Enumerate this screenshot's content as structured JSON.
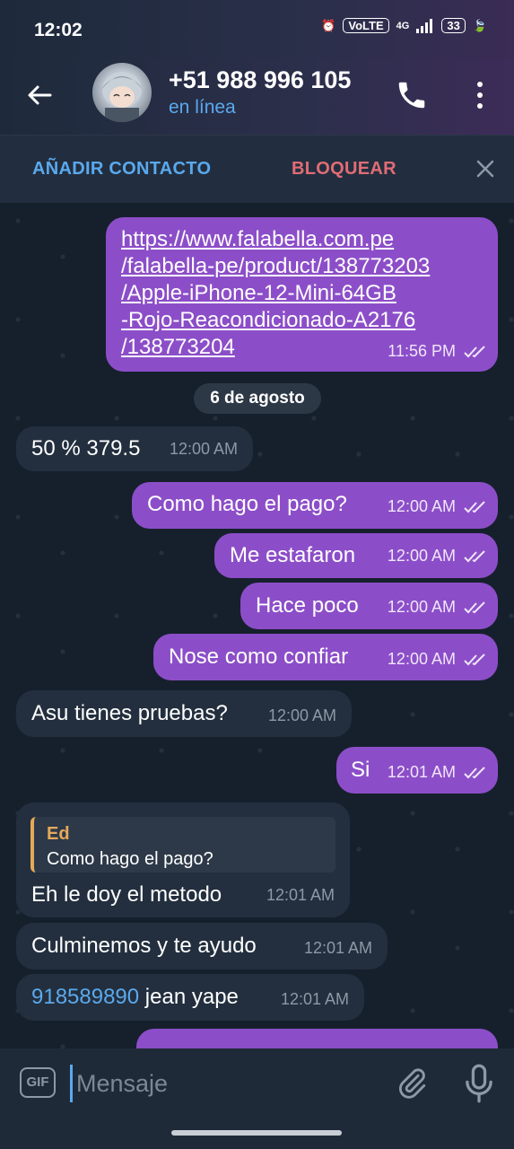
{
  "status": {
    "time": "12:02",
    "network": "4G",
    "volte": "VoLTE",
    "battery": "33"
  },
  "header": {
    "contact_name": "+51 988 996 105",
    "contact_status": "en línea"
  },
  "actions": {
    "add_contact": "AÑADIR CONTACTO",
    "block": "BLOQUEAR"
  },
  "chat": {
    "link_message": {
      "lines": [
        "https://www.falabella.com.pe",
        "/falabella-pe/product/138773203",
        "/Apple-iPhone-12-Mini-64GB",
        "-Rojo-Reacondicionado-A2176",
        "/138773204"
      ],
      "time": "11:56 PM"
    },
    "date_separator": "6 de agosto",
    "messages": [
      {
        "dir": "in",
        "text": "50 % 379.5",
        "time": "12:00 AM"
      },
      {
        "dir": "out",
        "text": "Como hago el pago?",
        "time": "12:00 AM"
      },
      {
        "dir": "out",
        "text": "Me estafaron",
        "time": "12:00 AM"
      },
      {
        "dir": "out",
        "text": "Hace poco",
        "time": "12:00 AM"
      },
      {
        "dir": "out",
        "text": "Nose como confiar",
        "time": "12:00 AM"
      },
      {
        "dir": "in",
        "text": "Asu tienes pruebas?",
        "time": "12:00 AM"
      },
      {
        "dir": "out",
        "text": "Si",
        "time": "12:01 AM"
      }
    ],
    "reply_message": {
      "quote_author": "Ed",
      "quote_text": "Como hago el pago?",
      "text": "Eh le doy el metodo",
      "time": "12:01 AM"
    },
    "later_messages": [
      {
        "dir": "in",
        "text": "Culminemos y te ayudo",
        "time": "12:01 AM"
      },
      {
        "dir": "in",
        "phone": "918589890",
        "text": " jean yape",
        "time": "12:01 AM"
      }
    ]
  },
  "composer": {
    "gif_label": "GIF",
    "placeholder": "Mensaje"
  }
}
